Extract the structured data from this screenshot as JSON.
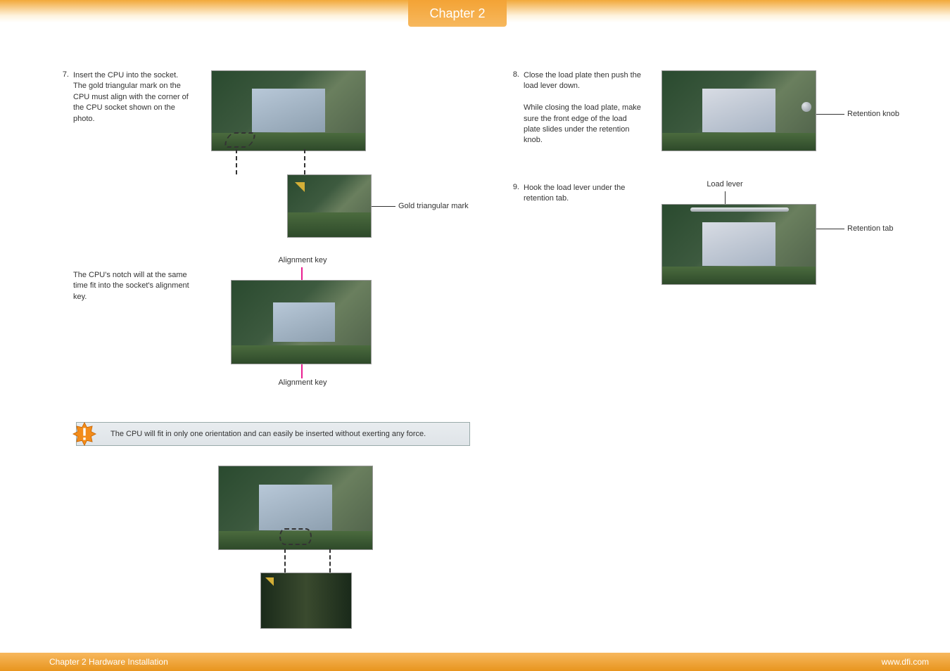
{
  "page": {
    "chapter_tab": "Chapter 2",
    "footer_left": "Chapter 2 Hardware Installation",
    "footer_right": "www.dfi.com"
  },
  "steps": {
    "s7": {
      "num": "7.",
      "text": "Insert the CPU into the socket. The gold triangular mark on the CPU must align with the corner of the CPU socket shown on the photo.",
      "callout_gold": "Gold triangular mark",
      "align_key_top": "Alignment key",
      "align_key_bottom": "Alignment key",
      "subtext": "The CPU's notch will at the same time fit into the socket's alignment key."
    },
    "s8": {
      "num": "8.",
      "text": "Close the load plate then push the load lever down.",
      "text2": "While closing the load plate, make sure the front edge of the load plate slides under the retention knob.",
      "callout_knob": "Retention knob"
    },
    "s9": {
      "num": "9.",
      "text": "Hook the load lever under the retention tab.",
      "callout_lever": "Load lever",
      "callout_tab": "Retention tab"
    }
  },
  "important": {
    "text": "The CPU will fit in only one orientation and can easily be inserted without exerting any force."
  }
}
